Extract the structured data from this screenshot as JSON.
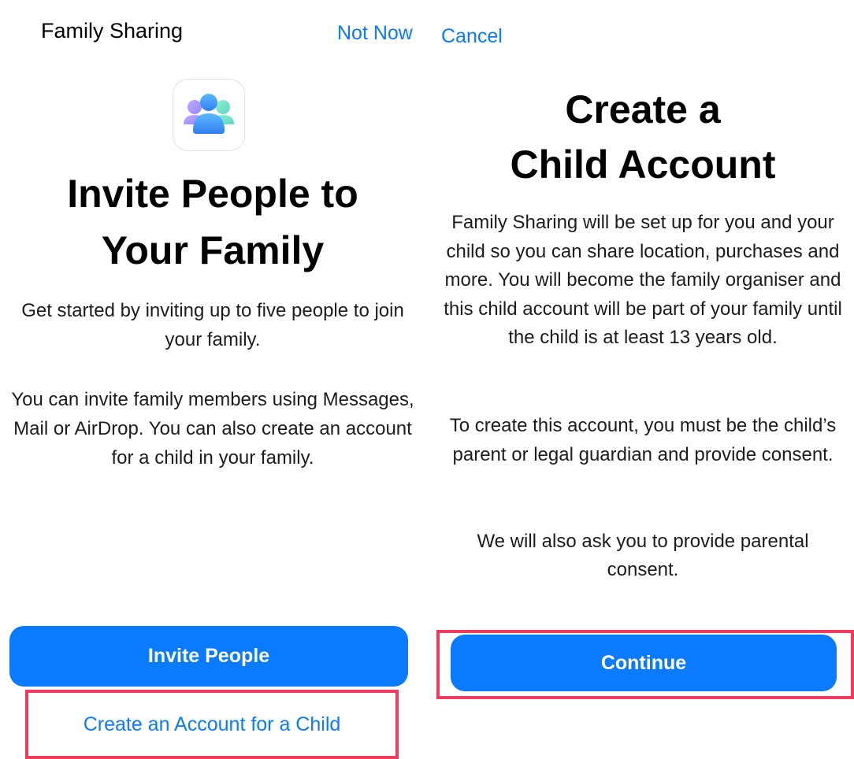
{
  "left_screen": {
    "nav": {
      "title": "Family Sharing",
      "not_now": "Not Now"
    },
    "app_icon": "family-sharing-icon",
    "headline_line1": "Invite People to",
    "headline_line2": "Your Family",
    "paragraph1": "Get started by inviting up to five people to join your family.",
    "paragraph2": "You can invite family members using Messages, Mail or AirDrop. You can also create an account for a child in your family.",
    "invite_button": "Invite People",
    "child_account_link": "Create an Account for a Child"
  },
  "right_screen": {
    "nav": {
      "cancel": "Cancel"
    },
    "headline_line1": "Create a",
    "headline_line2": "Child Account",
    "paragraph1": "Family Sharing will be set up for you and your child so you can share location, purchases and more. You will become the family organiser and this child account will be part of your family until the child is at least 13 years old.",
    "paragraph2": "To create this account, you must be the child’s parent or legal guardian and provide consent.",
    "paragraph3": "We will also ask you to provide parental consent.",
    "continue_button": "Continue"
  },
  "colors": {
    "accent": "#0a7bff",
    "highlight": "#ef3b5e",
    "background": "#ffffff"
  }
}
